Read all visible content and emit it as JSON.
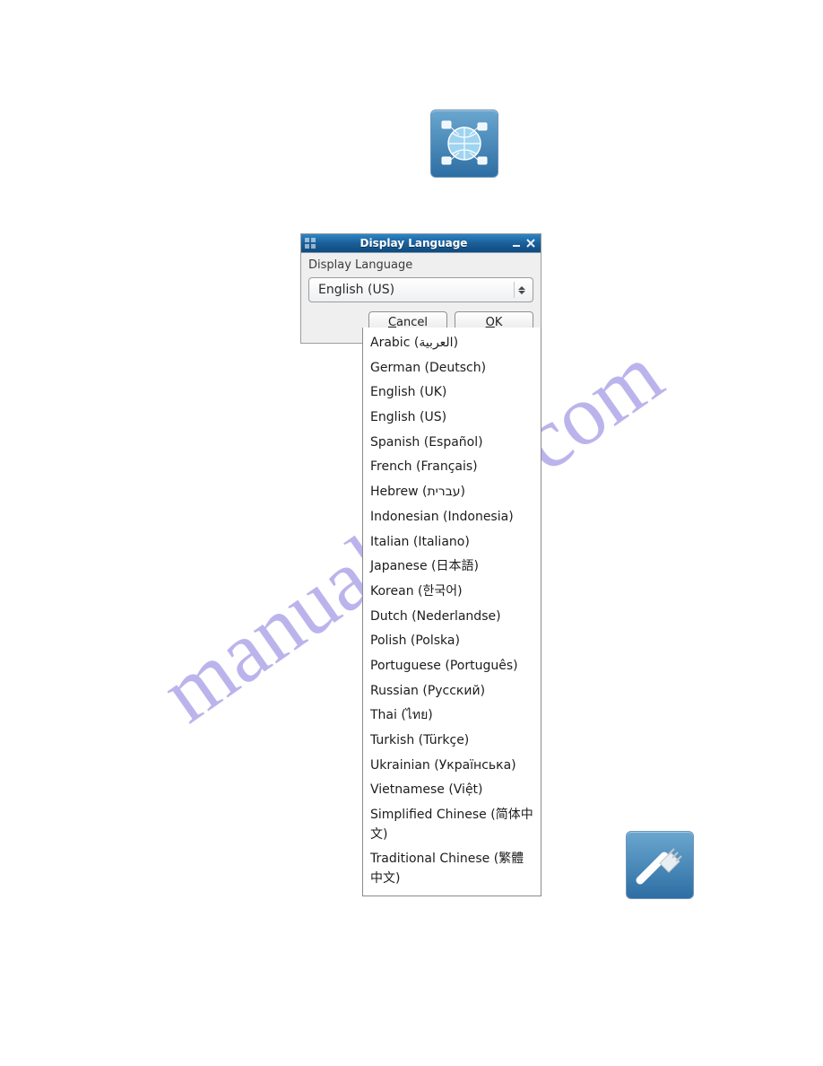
{
  "watermark": "manualslive.com",
  "dialog": {
    "title": "Display Language",
    "label": "Display Language",
    "selected": "English (US)",
    "buttons": {
      "cancel": "Cancel",
      "ok": "OK",
      "cancel_mn": "C",
      "ok_mn": "O"
    }
  },
  "languages": [
    "Arabic (العربية)",
    "German (Deutsch)",
    "English (UK)",
    "English (US)",
    "Spanish (Español)",
    "French (Français)",
    "Hebrew (עברית)",
    "Indonesian (Indonesia)",
    "Italian (Italiano)",
    "Japanese (日本語)",
    "Korean (한국어)",
    "Dutch (Nederlandse)",
    "Polish (Polska)",
    "Portuguese (Português)",
    "Russian (Русский)",
    "Thai (ไทย)",
    "Turkish (Türkçe)",
    "Ukrainian (Українська)",
    "Vietnamese (Việt)",
    "Simplified Chinese (简体中文)",
    "Traditional Chinese (繁體中文)"
  ],
  "icons": {
    "globe": "globe-network-icon",
    "cable": "network-cable-icon"
  }
}
